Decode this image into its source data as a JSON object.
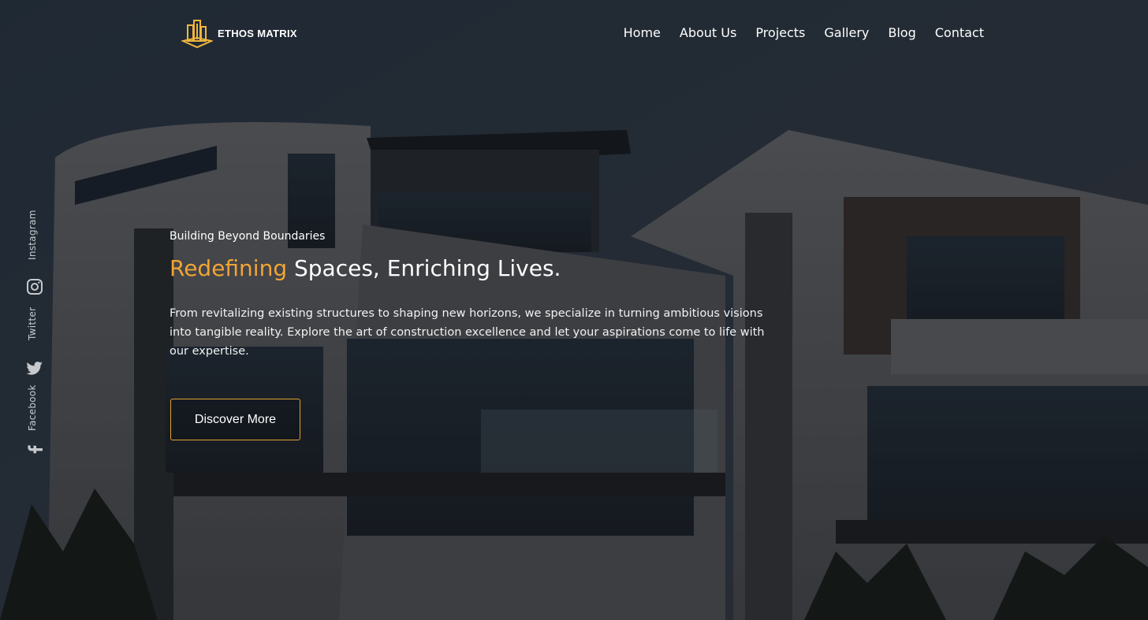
{
  "brand": {
    "name": "ETHOS MATRIX",
    "accent_color": "#f0a535"
  },
  "nav": {
    "items": [
      {
        "label": "Home"
      },
      {
        "label": "About Us"
      },
      {
        "label": "Projects"
      },
      {
        "label": "Gallery"
      },
      {
        "label": "Blog"
      },
      {
        "label": "Contact"
      }
    ]
  },
  "socials": {
    "instagram": "Instagram",
    "twitter": "Twitter",
    "facebook": "Facebook"
  },
  "hero": {
    "eyebrow": "Building Beyond Boundaries",
    "headline_accent": "Redefining",
    "headline_rest": " Spaces, Enriching Lives.",
    "body": "From revitalizing existing structures to shaping new horizons, we specialize in turning ambitious visions into tangible reality. Explore the art of construction excellence and let your aspirations come to life with our expertise.",
    "cta_label": "Discover More",
    "background_description_icon": "modern-building-photo"
  }
}
